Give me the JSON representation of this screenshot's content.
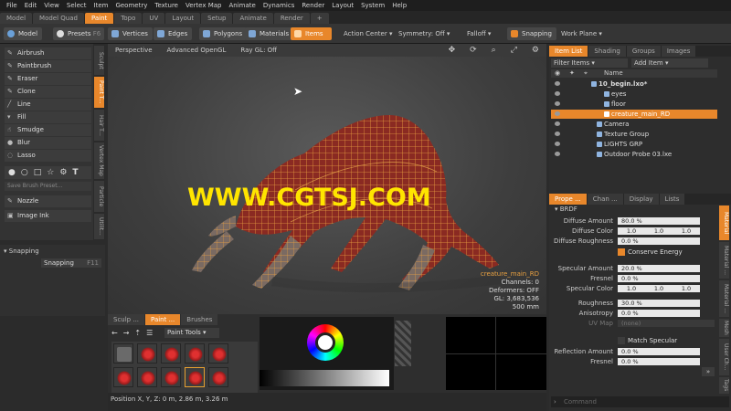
{
  "menu": [
    "File",
    "Edit",
    "View",
    "Select",
    "Item",
    "Geometry",
    "Texture",
    "Vertex Map",
    "Animate",
    "Dynamics",
    "Render",
    "Layout",
    "System",
    "Help"
  ],
  "layout_tabs": [
    {
      "label": "Model",
      "active": false
    },
    {
      "label": "Model Quad",
      "active": false
    },
    {
      "label": "Paint",
      "active": true
    },
    {
      "label": "Topo",
      "active": false
    },
    {
      "label": "UV",
      "active": false
    },
    {
      "label": "Layout",
      "active": false
    },
    {
      "label": "Setup",
      "active": false
    },
    {
      "label": "Animate",
      "active": false
    },
    {
      "label": "Render",
      "active": false
    },
    {
      "label": "+",
      "active": false
    }
  ],
  "toolbar": {
    "model": "Model",
    "presets": "Presets",
    "presets_key": "F6",
    "vertices": "Vertices",
    "edges": "Edges",
    "polygons": "Polygons",
    "materials": "Materials",
    "items": "Items",
    "action_center": "Action Center",
    "symmetry": "Symmetry: Off",
    "falloff": "Falloff",
    "snapping": "Snapping",
    "work_plane": "Work Plane"
  },
  "tools": [
    "Airbrush",
    "Paintbrush",
    "Eraser",
    "Clone",
    "Line",
    "Fill",
    "Smudge",
    "Blur",
    "Lasso"
  ],
  "brush_preset_placeholder": "Save Brush Preset...",
  "nozzle": "Nozzle",
  "image_ink": "Image Ink",
  "left_vtabs": [
    "Sculpt",
    "Paint T...",
    "Hair T...",
    "Vertex Map",
    "Particle",
    "Utilit..."
  ],
  "snapping_panel": {
    "header": "Snapping",
    "button": "Snapping",
    "key": "F11"
  },
  "viewport": {
    "perspective": "Perspective",
    "renderer": "Advanced OpenGL",
    "raygl": "Ray GL: Off",
    "selected": "creature_main_RD",
    "channels": "Channels: 0",
    "deformers": "Deformers: OFF",
    "gl": "GL: 3,683,536",
    "scale": "500 mm"
  },
  "watermark": "WWW.CGTSJ.COM",
  "bottom_tabs": [
    {
      "label": "Sculp ...",
      "active": false
    },
    {
      "label": "Paint ...",
      "active": true
    },
    {
      "label": "Brushes",
      "active": false
    }
  ],
  "paint_tools_dropdown": "Paint Tools",
  "status": "Position X, Y, Z:  0 m, 2.86 m, 3.26 m",
  "item_list": {
    "tabs": [
      {
        "label": "Item List",
        "active": true
      },
      {
        "label": "Shading",
        "active": false
      },
      {
        "label": "Groups",
        "active": false
      },
      {
        "label": "Images",
        "active": false
      }
    ],
    "filter": "Filter Items",
    "add_item": "Add Item",
    "name_col": "Name",
    "items": [
      {
        "label": "10_begin.lxo*",
        "bold": true,
        "selected": false
      },
      {
        "label": "eyes",
        "bold": false,
        "selected": false
      },
      {
        "label": "floor",
        "bold": false,
        "selected": false
      },
      {
        "label": "creature_main_RD",
        "bold": false,
        "selected": true
      },
      {
        "label": "Camera",
        "bold": false,
        "selected": false
      },
      {
        "label": "Texture Group",
        "bold": false,
        "selected": false
      },
      {
        "label": "LIGHTS GRP",
        "bold": false,
        "selected": false
      },
      {
        "label": "Outdoor Probe 03.lxe",
        "bold": false,
        "selected": false
      }
    ]
  },
  "properties": {
    "tabs": [
      {
        "label": "Prope ...",
        "active": true
      },
      {
        "label": "Chan ...",
        "active": false
      },
      {
        "label": "Display",
        "active": false
      },
      {
        "label": "Lists",
        "active": false
      }
    ],
    "section": "BRDF",
    "diffuse_amount_label": "Diffuse Amount",
    "diffuse_amount": "80.0 %",
    "diffuse_color_label": "Diffuse Color",
    "diffuse_color": [
      "1.0",
      "1.0",
      "1.0"
    ],
    "diffuse_roughness_label": "Diffuse Roughness",
    "diffuse_roughness": "0.0 %",
    "conserve_energy": "Conserve Energy",
    "specular_amount_label": "Specular Amount",
    "specular_amount": "20.0 %",
    "fresnel_label": "Fresnel",
    "fresnel": "0.0 %",
    "specular_color_label": "Specular Color",
    "specular_color": [
      "1.0",
      "1.0",
      "1.0"
    ],
    "roughness_label": "Roughness",
    "roughness": "30.0 %",
    "anisotropy_label": "Anisotropy",
    "anisotropy": "0.0 %",
    "uv_map_label": "UV Map",
    "uv_map": "(none)",
    "match_specular": "Match Specular",
    "reflection_amount_label": "Reflection Amount",
    "reflection_amount": "0.0 %",
    "fresnel2_label": "Fresnel",
    "fresnel2": "0.0 %",
    "command_placeholder": "Command",
    "vtabs": [
      "Material",
      "Material ...",
      "Material ...",
      "Mesh",
      "User Ch...",
      "Tags"
    ]
  }
}
